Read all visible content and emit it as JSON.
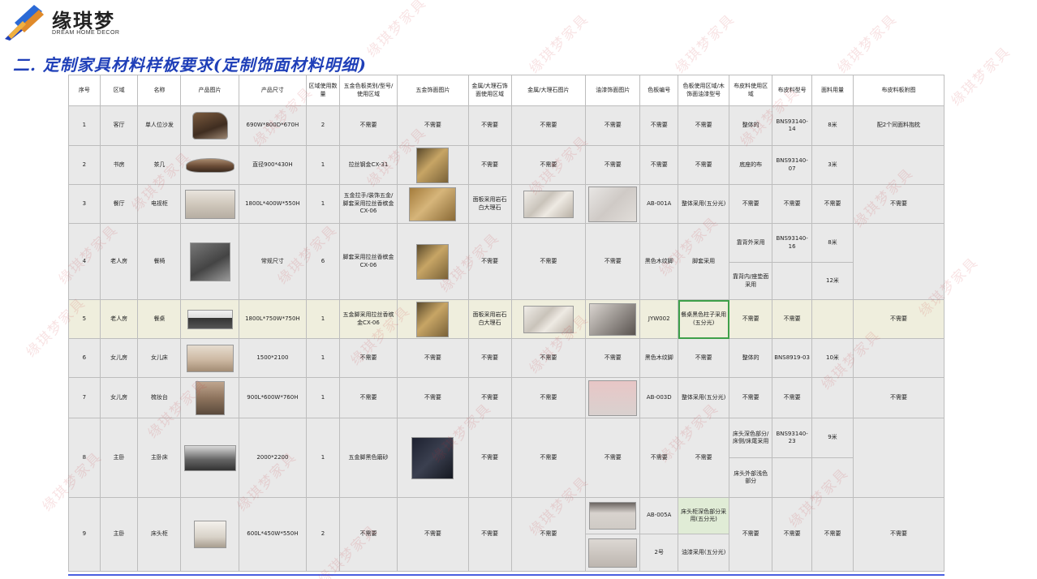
{
  "brand": {
    "name": "缘琪梦",
    "tagline": "DREAM HOME DECOR"
  },
  "section_title": "二. 定制家具材料样板要求(定制饰面材料明细)",
  "watermark_text": "缘琪梦家具",
  "table": {
    "headers": [
      "序号",
      "区域",
      "名称",
      "产品图片",
      "产品尺寸",
      "区域使用数量",
      "五金色板类别/型号/使用区域",
      "五金饰面图片",
      "金属/大理石饰面使用区域",
      "金属/大理石图片",
      "油漆饰面图片",
      "色板编号",
      "色板使用区域/木饰面油漆型号",
      "布皮料使用区域",
      "布皮料型号",
      "面料用量",
      "布皮料板附图"
    ],
    "rows": [
      [
        "1",
        "客厅",
        "单人位沙发",
        "",
        "690W*800D*670H",
        "2",
        "不需要",
        "不需要",
        "不需要",
        "不需要",
        "不需要",
        "不需要",
        "不需要",
        "整体的",
        "BNS93140-14",
        "8米",
        "配2个同面料抱枕"
      ],
      [
        "2",
        "书房",
        "茶几",
        "",
        "直径900*430H",
        "1",
        "拉丝钢金CX-31",
        "",
        "不需要",
        "不需要",
        "不需要",
        "不需要",
        "不需要",
        "底座的布",
        "BNS93140-07",
        "3米",
        ""
      ],
      [
        "3",
        "餐厅",
        "电视柜",
        "",
        "1800L*400W*550H",
        "1",
        "五金拉手/装饰五金/脚套采用拉丝香槟金CX-06",
        "",
        "面板采用岩石白大理石",
        "",
        "",
        "AB-001A",
        "整体采用(五分光)",
        "不需要",
        "不需要",
        "不需要",
        "不需要"
      ],
      [
        "4",
        "老人房",
        "餐椅",
        "",
        "常规尺寸",
        "6",
        "脚套采用拉丝香槟金CX-06",
        "",
        "不需要",
        "不需要",
        "不需要",
        "黑色木纹脚",
        "脚套采用",
        "靠背外采用",
        "BNS93140-16",
        "8米",
        ""
      ],
      [
        "",
        "",
        "",
        "",
        "",
        "",
        "",
        "",
        "",
        "",
        "",
        "",
        "",
        "靠背内/座垫面采用",
        "",
        "12米",
        ""
      ],
      [
        "5",
        "老人房",
        "餐桌",
        "",
        "1800L*750W*750H",
        "1",
        "五金脚采用拉丝香槟金CX-06",
        "",
        "面板采用岩石白大理石",
        "",
        "",
        "JYW002",
        "餐桌黑色柱子采用(五分光)",
        "不需要",
        "不需要",
        "",
        "不需要"
      ],
      [
        "6",
        "女儿房",
        "女儿床",
        "",
        "1500*2100",
        "1",
        "不需要",
        "不需要",
        "不需要",
        "不需要",
        "不需要",
        "黑色木纹脚",
        "不需要",
        "整体的",
        "BNS8919-03",
        "10米",
        ""
      ],
      [
        "7",
        "女儿房",
        "梳妆台",
        "",
        "900L*600W*760H",
        "1",
        "不需要",
        "不需要",
        "不需要",
        "不需要",
        "",
        "AB-003D",
        "整体采用(五分光)",
        "不需要",
        "不需要",
        "",
        "不需要"
      ],
      [
        "8",
        "主卧",
        "主卧床",
        "",
        "2000*2200",
        "1",
        "五金脚黑色磨砂",
        "",
        "不需要",
        "不需要",
        "不需要",
        "不需要",
        "不需要",
        "床头深色部分/床侧/床尾采用",
        "BNS93140-23",
        "9米",
        ""
      ],
      [
        "",
        "",
        "",
        "",
        "",
        "",
        "",
        "",
        "",
        "",
        "",
        "",
        "",
        "床头外部浅色部分",
        "",
        "",
        ""
      ],
      [
        "9",
        "主卧",
        "床头柜",
        "",
        "600L*450W*550H",
        "2",
        "不需要",
        "不需要",
        "不需要",
        "不需要",
        "",
        "AB-005A",
        "床头柜深色部分采用(五分光)",
        "不需要",
        "不需要",
        "不需要",
        "不需要"
      ],
      [
        "",
        "",
        "",
        "",
        "",
        "",
        "",
        "",
        "",
        "",
        "",
        "2号",
        "油漆采用(五分光)",
        "",
        "",
        "",
        ""
      ]
    ]
  }
}
